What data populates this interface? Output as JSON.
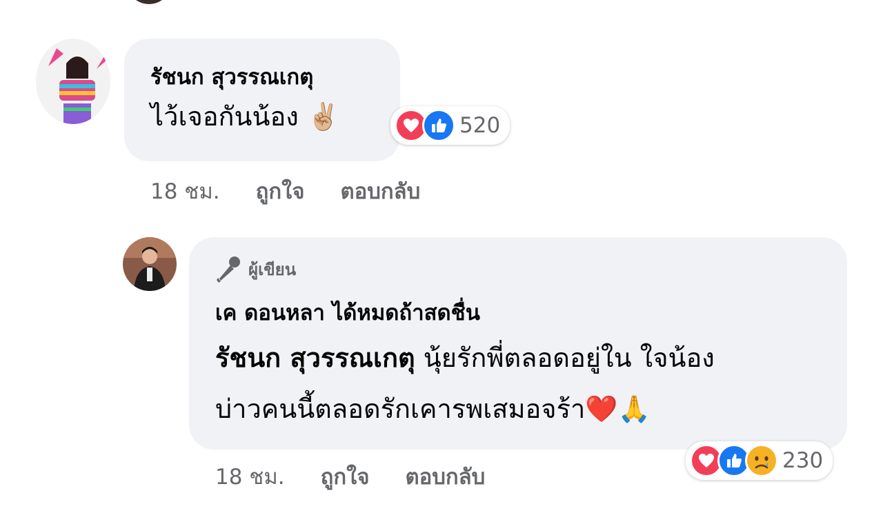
{
  "comment1": {
    "author": "รัชนก สุวรรณเกตุ",
    "text": "ไว้เจอกันน้อง",
    "emoji": "✌🏼",
    "reaction_count": "520",
    "reaction_icons": [
      "love-icon",
      "like-icon"
    ],
    "time": "18 ชม.",
    "like_label": "ถูกใจ",
    "reply_label": "ตอบกลับ"
  },
  "comment2": {
    "badge_label": "ผู้เขียน",
    "author": "เค ดอนหลา ได้หมดถ้าสดชื่น",
    "mention": "รัชนก สุวรรณเกตุ",
    "text_line1": " นุ้ยรักพี่ตลอดอยู่ใน ใจน้อง",
    "text_line2": "บ่าวคนนี้ตลอดรักเคารพเสมอจร้า",
    "emoji": "❤️🙏",
    "reaction_count": "230",
    "reaction_icons": [
      "love-icon",
      "like-icon",
      "sad-icon"
    ],
    "time": "18 ชม.",
    "like_label": "ถูกใจ",
    "reply_label": "ตอบกลับ"
  },
  "colors": {
    "bubble": "#f0f2f5",
    "secondary_text": "#65676b",
    "like_blue": "#1877f2",
    "love_red": "#f33e58",
    "sad_yellow": "#f7b125"
  }
}
